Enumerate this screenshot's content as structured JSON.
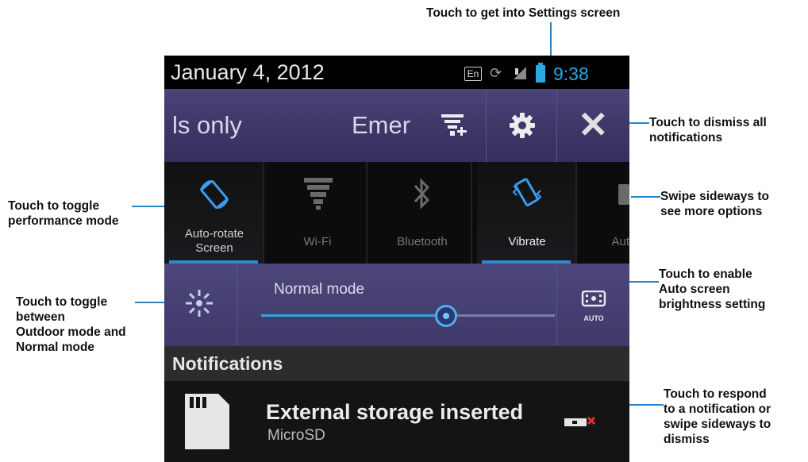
{
  "callouts": {
    "settings": "Touch to get into Settings screen",
    "dismiss_all": "Touch to dismiss all\nnotifications",
    "performance": "Touch to toggle\nperformance mode",
    "swipe": "Swipe sideways to\nsee more options",
    "outdoor": "Touch to toggle\nbetween\nOutdoor mode and\nNormal mode",
    "auto_brightness": "Touch to enable\nAuto screen\nbrightness setting",
    "respond": "Touch to respond\nto a notification or\nswipe sideways to\ndismiss"
  },
  "status_bar": {
    "date": "January 4, 2012",
    "lang": "En",
    "time": "9:38"
  },
  "top_row": {
    "profile_label": "ls only",
    "emergency_label": "Emer"
  },
  "toggles": [
    {
      "label": "Auto-rotate\nScreen",
      "active": true,
      "icon": "rotate-icon"
    },
    {
      "label": "Wi-Fi",
      "active": false,
      "icon": "wifi-icon"
    },
    {
      "label": "Bluetooth",
      "active": false,
      "icon": "bluetooth-icon"
    },
    {
      "label": "Vibrate",
      "active": true,
      "icon": "vibrate-icon"
    },
    {
      "label": "Aut",
      "active": false,
      "icon": "auto-icon"
    }
  ],
  "brightness": {
    "mode_label": "Normal mode",
    "level": 0.63,
    "auto_label": "AUTO"
  },
  "notifications": {
    "header": "Notifications",
    "item": {
      "title": "External storage inserted",
      "subtitle": "MicroSD"
    }
  },
  "colors": {
    "accent": "#2ba8e0",
    "callout_line": "#2a84c8",
    "panel_purple": "#3f3a6a"
  }
}
